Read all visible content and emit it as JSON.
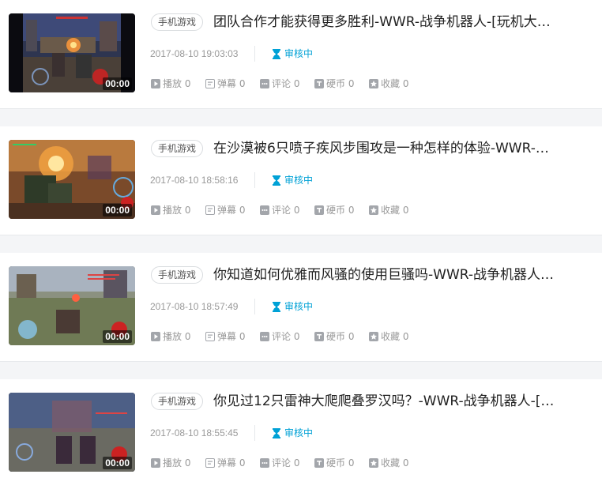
{
  "colors": {
    "accent": "#00a1d6",
    "meta_text": "#999999",
    "title_text": "#212121"
  },
  "items": [
    {
      "category": "手机游戏",
      "title": "团队合作才能获得更多胜利-WWR-战争机器人-[玩机大…",
      "duration": "00:00",
      "time": "2017-08-10 19:03:03",
      "status": "审核中",
      "stats": {
        "play": "播放 0",
        "danmaku": "弹幕 0",
        "comment": "评论 0",
        "coin": "硬币 0",
        "favorite": "收藏 0"
      }
    },
    {
      "category": "手机游戏",
      "title": "在沙漠被6只喷子疾风步围攻是一种怎样的体验-WWR-…",
      "duration": "00:00",
      "time": "2017-08-10 18:58:16",
      "status": "审核中",
      "stats": {
        "play": "播放 0",
        "danmaku": "弹幕 0",
        "comment": "评论 0",
        "coin": "硬币 0",
        "favorite": "收藏 0"
      }
    },
    {
      "category": "手机游戏",
      "title": "你知道如何优雅而风骚的使用巨骚吗-WWR-战争机器人…",
      "duration": "00:00",
      "time": "2017-08-10 18:57:49",
      "status": "审核中",
      "stats": {
        "play": "播放 0",
        "danmaku": "弹幕 0",
        "comment": "评论 0",
        "coin": "硬币 0",
        "favorite": "收藏 0"
      }
    },
    {
      "category": "手机游戏",
      "title": "你见过12只雷神大爬爬叠罗汉吗？-WWR-战争机器人-[…",
      "duration": "00:00",
      "time": "2017-08-10 18:55:45",
      "status": "审核中",
      "stats": {
        "play": "播放 0",
        "danmaku": "弹幕 0",
        "comment": "评论 0",
        "coin": "硬币 0",
        "favorite": "收藏 0"
      }
    }
  ]
}
